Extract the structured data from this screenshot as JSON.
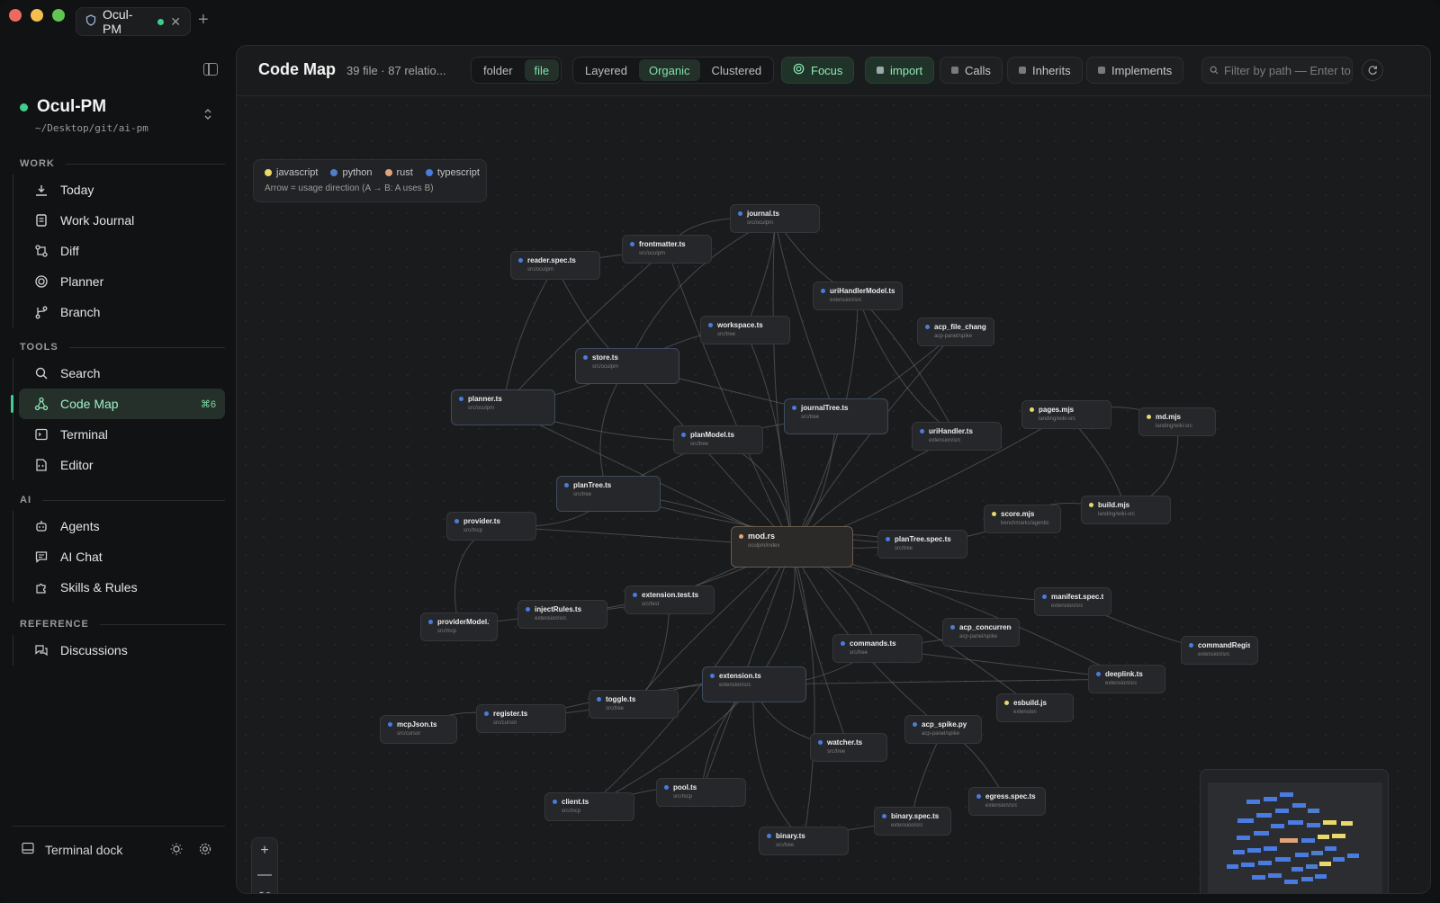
{
  "app": {
    "tab_title": "Ocul-PM",
    "tab_close": "✕",
    "tab_add": "+"
  },
  "sidebar": {
    "project_name": "Ocul-PM",
    "project_path": "~/Desktop/git/ai-pm",
    "sections": {
      "work": "WORK",
      "tools": "TOOLS",
      "ai": "AI",
      "reference": "REFERENCE"
    },
    "work_items": [
      {
        "label": "Today",
        "icon": "today-icon"
      },
      {
        "label": "Work Journal",
        "icon": "journal-icon"
      },
      {
        "label": "Diff",
        "icon": "diff-icon"
      },
      {
        "label": "Planner",
        "icon": "planner-icon"
      },
      {
        "label": "Branch",
        "icon": "branch-icon"
      }
    ],
    "tool_items": [
      {
        "label": "Search",
        "icon": "search-icon"
      },
      {
        "label": "Code Map",
        "icon": "code-map-icon",
        "shortcut": "⌘6",
        "active": true
      },
      {
        "label": "Terminal",
        "icon": "terminal-icon"
      },
      {
        "label": "Editor",
        "icon": "editor-icon"
      }
    ],
    "ai_items": [
      {
        "label": "Agents",
        "icon": "agents-icon"
      },
      {
        "label": "AI Chat",
        "icon": "chat-icon"
      },
      {
        "label": "Skills & Rules",
        "icon": "puzzle-icon"
      }
    ],
    "reference_items": [
      {
        "label": "Discussions",
        "icon": "discussions-icon"
      }
    ],
    "terminal_dock": "Terminal dock"
  },
  "toolbar": {
    "title": "Code Map",
    "stats": "39 file · 87 relatio...",
    "granularity": {
      "options": [
        "folder",
        "file"
      ],
      "selected": "file"
    },
    "layout": {
      "options": [
        "Layered",
        "Organic",
        "Clustered"
      ],
      "selected": "Organic"
    },
    "focus_label": "Focus",
    "edge_filters": [
      {
        "label": "import",
        "on": true
      },
      {
        "label": "Calls",
        "on": false
      },
      {
        "label": "Inherits",
        "on": false
      },
      {
        "label": "Implements",
        "on": false
      }
    ],
    "filter_placeholder": "Filter by path — Enter to"
  },
  "legend": {
    "languages": [
      {
        "label": "javascript",
        "color": "#e8d96a"
      },
      {
        "label": "python",
        "color": "#4f7fc9"
      },
      {
        "label": "rust",
        "color": "#e0a37a"
      },
      {
        "label": "typescript",
        "color": "#4a7be0"
      }
    ],
    "note": "Arrow = usage direction (A → B: A uses B)"
  },
  "colors": {
    "accent": "#3ecf8e",
    "typescript": "#4a7be0",
    "javascript": "#e8d96a",
    "rust": "#e0a37a"
  },
  "graph": {
    "nodes": [
      {
        "id": "journal",
        "name": "journal.ts",
        "path": "src/oculpm",
        "lang": "typescript"
      },
      {
        "id": "frontmatter",
        "name": "frontmatter.ts",
        "path": "src/oculpm",
        "lang": "typescript"
      },
      {
        "id": "readerspec",
        "name": "reader.spec.ts",
        "path": "src/oculpm",
        "lang": "typescript"
      },
      {
        "id": "urihandlermodel",
        "name": "uriHandlerModel.ts",
        "path": "extension/src",
        "lang": "typescript"
      },
      {
        "id": "workspace",
        "name": "workspace.ts",
        "path": "src/tree",
        "lang": "typescript"
      },
      {
        "id": "acpfilechange",
        "name": "acp_file_change_...",
        "path": "acp-panel/spike",
        "lang": "python"
      },
      {
        "id": "store",
        "name": "store.ts",
        "path": "src/oculpm",
        "lang": "typescript"
      },
      {
        "id": "planner",
        "name": "planner.ts",
        "path": "src/oculpm",
        "lang": "typescript"
      },
      {
        "id": "journaltree",
        "name": "journalTree.ts",
        "path": "src/tree",
        "lang": "typescript"
      },
      {
        "id": "planmodel",
        "name": "planModel.ts",
        "path": "src/tree",
        "lang": "typescript"
      },
      {
        "id": "urihandler",
        "name": "uriHandler.ts",
        "path": "extension/src",
        "lang": "typescript"
      },
      {
        "id": "pages",
        "name": "pages.mjs",
        "path": "landing/wiki-src",
        "lang": "javascript"
      },
      {
        "id": "md",
        "name": "md.mjs",
        "path": "landing/wiki-src",
        "lang": "javascript"
      },
      {
        "id": "plantree",
        "name": "planTree.ts",
        "path": "src/tree",
        "lang": "typescript"
      },
      {
        "id": "provider",
        "name": "provider.ts",
        "path": "src/mcp",
        "lang": "typescript"
      },
      {
        "id": "score",
        "name": "score.mjs",
        "path": "benchmarks/agentic",
        "lang": "javascript"
      },
      {
        "id": "build",
        "name": "build.mjs",
        "path": "landing/wiki-src",
        "lang": "javascript"
      },
      {
        "id": "mod",
        "name": "mod.rs",
        "path": "oculpm/index",
        "lang": "rust"
      },
      {
        "id": "plantreespec",
        "name": "planTree.spec.ts",
        "path": "src/tree",
        "lang": "typescript"
      },
      {
        "id": "extensiontest",
        "name": "extension.test.ts",
        "path": "src/test",
        "lang": "typescript"
      },
      {
        "id": "manifestspec",
        "name": "manifest.spec.ts",
        "path": "extension/src",
        "lang": "typescript"
      },
      {
        "id": "injectrules",
        "name": "injectRules.ts",
        "path": "extension/src",
        "lang": "typescript"
      },
      {
        "id": "providermodel",
        "name": "providerModel.ts",
        "path": "src/mcp",
        "lang": "typescript"
      },
      {
        "id": "acpconcurrency",
        "name": "acp_concurrency...",
        "path": "acp-panel/spike",
        "lang": "python"
      },
      {
        "id": "commands",
        "name": "commands.ts",
        "path": "src/tree",
        "lang": "typescript"
      },
      {
        "id": "commandregistr",
        "name": "commandRegistr...",
        "path": "extension/src",
        "lang": "typescript"
      },
      {
        "id": "deeplink",
        "name": "deeplink.ts",
        "path": "extension/src",
        "lang": "typescript"
      },
      {
        "id": "extension",
        "name": "extension.ts",
        "path": "extension/src",
        "lang": "typescript"
      },
      {
        "id": "toggle",
        "name": "toggle.ts",
        "path": "src/tree",
        "lang": "typescript"
      },
      {
        "id": "esbuild",
        "name": "esbuild.js",
        "path": "extension",
        "lang": "javascript"
      },
      {
        "id": "register",
        "name": "register.ts",
        "path": "src/cursor",
        "lang": "typescript"
      },
      {
        "id": "mcpjson",
        "name": "mcpJson.ts",
        "path": "src/cursor",
        "lang": "typescript"
      },
      {
        "id": "acpspike",
        "name": "acp_spike.py",
        "path": "acp-panel/spike",
        "lang": "python"
      },
      {
        "id": "watcher",
        "name": "watcher.ts",
        "path": "src/tree",
        "lang": "typescript"
      },
      {
        "id": "egressspec",
        "name": "egress.spec.ts",
        "path": "extension/src",
        "lang": "typescript"
      },
      {
        "id": "pool",
        "name": "pool.ts",
        "path": "src/mcp",
        "lang": "typescript"
      },
      {
        "id": "client",
        "name": "client.ts",
        "path": "src/mcp",
        "lang": "typescript"
      },
      {
        "id": "binaryspec",
        "name": "binary.spec.ts",
        "path": "extension/src",
        "lang": "typescript"
      },
      {
        "id": "binary",
        "name": "binary.ts",
        "path": "src/tree",
        "lang": "typescript"
      }
    ],
    "edges": [
      [
        "frontmatter",
        "journal"
      ],
      [
        "readerspec",
        "frontmatter"
      ],
      [
        "readerspec",
        "store"
      ],
      [
        "store",
        "workspace"
      ],
      [
        "planner",
        "store"
      ],
      [
        "planner",
        "frontmatter"
      ],
      [
        "journaltree",
        "journal"
      ],
      [
        "journaltree",
        "store"
      ],
      [
        "planmodel",
        "planner"
      ],
      [
        "plantree",
        "planmodel"
      ],
      [
        "plantree",
        "store"
      ],
      [
        "urihandler",
        "urihandlermodel"
      ],
      [
        "pages",
        "md"
      ],
      [
        "build",
        "pages"
      ],
      [
        "build",
        "md"
      ],
      [
        "score",
        "build"
      ],
      [
        "mod",
        "journal"
      ],
      [
        "mod",
        "frontmatter"
      ],
      [
        "mod",
        "workspace"
      ],
      [
        "mod",
        "urihandlermodel"
      ],
      [
        "mod",
        "acpfilechange"
      ],
      [
        "mod",
        "store"
      ],
      [
        "mod",
        "planner"
      ],
      [
        "mod",
        "journaltree"
      ],
      [
        "mod",
        "planmodel"
      ],
      [
        "mod",
        "urihandler"
      ],
      [
        "mod",
        "pages"
      ],
      [
        "mod",
        "plantree"
      ],
      [
        "mod",
        "provider"
      ],
      [
        "mod",
        "score"
      ],
      [
        "plantreespec",
        "mod"
      ],
      [
        "extensiontest",
        "mod"
      ],
      [
        "injectrules",
        "mod"
      ],
      [
        "commands",
        "mod"
      ],
      [
        "extension",
        "mod"
      ],
      [
        "toggle",
        "mod"
      ],
      [
        "watcher",
        "mod"
      ],
      [
        "pool",
        "mod"
      ],
      [
        "client",
        "mod"
      ],
      [
        "binary",
        "mod"
      ],
      [
        "acpspike",
        "mod"
      ],
      [
        "manifestspec",
        "mod"
      ],
      [
        "deeplink",
        "mod"
      ],
      [
        "esbuild",
        "mod"
      ],
      [
        "commandregistr",
        "manifestspec"
      ],
      [
        "providermodel",
        "provider"
      ],
      [
        "injectrules",
        "providermodel"
      ],
      [
        "extension",
        "commands"
      ],
      [
        "extension",
        "toggle"
      ],
      [
        "extension",
        "deeplink"
      ],
      [
        "extension",
        "watcher"
      ],
      [
        "register",
        "mcpjson"
      ],
      [
        "register",
        "toggle"
      ],
      [
        "toggle",
        "extensiontest"
      ],
      [
        "client",
        "pool"
      ],
      [
        "binary",
        "binaryspec"
      ],
      [
        "binaryspec",
        "acpspike"
      ],
      [
        "egressspec",
        "acpspike"
      ],
      [
        "acpconcurrency",
        "commands"
      ],
      [
        "provider",
        "plantree"
      ],
      [
        "store",
        "journal"
      ],
      [
        "planner",
        "readerspec"
      ],
      [
        "urihandlermodel",
        "journal"
      ],
      [
        "workspace",
        "journal"
      ],
      [
        "extension",
        "client"
      ],
      [
        "extension",
        "binary"
      ],
      [
        "extension",
        "pool"
      ],
      [
        "commands",
        "deeplink"
      ],
      [
        "plantreespec",
        "plantree"
      ],
      [
        "extension",
        "register"
      ],
      [
        "planmodel",
        "journaltree"
      ],
      [
        "acpfilechange",
        "journaltree"
      ],
      [
        "urihandler",
        "urihandlermodel"
      ],
      [
        "extensiontest",
        "injectrules"
      ]
    ]
  },
  "zoom": {
    "in": "+",
    "out": "—",
    "fit": "⛶"
  }
}
